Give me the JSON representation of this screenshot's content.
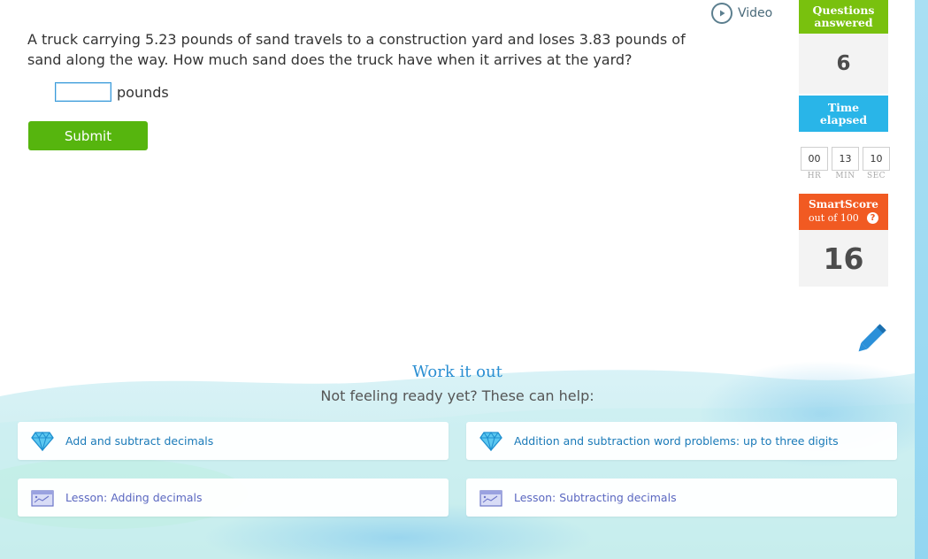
{
  "video": {
    "label": "Video"
  },
  "question": {
    "text": "A truck carrying 5.23 pounds of sand travels to a construction yard and loses 3.83 pounds of sand along the way. How much sand does the truck have when it arrives at the yard?",
    "answer_value": "",
    "unit": "pounds",
    "submit_label": "Submit"
  },
  "stats": {
    "questions_answered_label_line1": "Questions",
    "questions_answered_label_line2": "answered",
    "questions_answered_value": "6",
    "time_elapsed_label_line1": "Time",
    "time_elapsed_label_line2": "elapsed",
    "timer": {
      "hr": "00",
      "min": "13",
      "sec": "10"
    },
    "timer_labels": {
      "hr": "HR",
      "min": "MIN",
      "sec": "SEC"
    },
    "smartscore_label": "SmartScore",
    "smartscore_sub": "out of 100",
    "smartscore_help": "?",
    "smartscore_value": "16"
  },
  "help": {
    "title": "Work it out",
    "subtitle": "Not feeling ready yet? These can help:",
    "items": [
      {
        "label": "Add and subtract decimals",
        "icon": "diamond-icon"
      },
      {
        "label": "Addition and subtraction word problems: up to three digits",
        "icon": "diamond-icon"
      },
      {
        "label": "Lesson: Adding decimals",
        "icon": "lesson-icon"
      },
      {
        "label": "Lesson: Subtracting decimals",
        "icon": "lesson-icon"
      }
    ]
  },
  "colors": {
    "green": "#79c10e",
    "submit_green": "#56b50e",
    "blue": "#29b5e8",
    "orange": "#f15a22",
    "link_blue": "#1a7ab8"
  }
}
